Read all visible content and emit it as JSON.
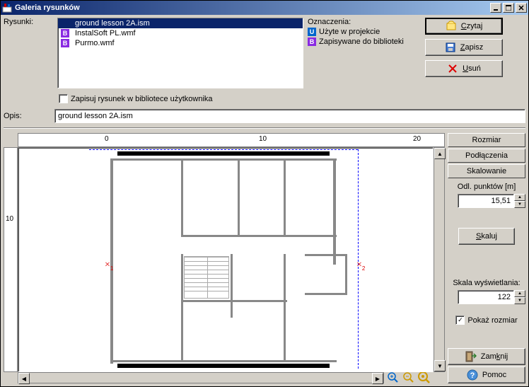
{
  "titlebar": {
    "text": "Galeria rysunków"
  },
  "labels": {
    "rysunki": "Rysunki:",
    "oznaczenia": "Oznaczenia:",
    "opis": "Opis:",
    "save_checkbox": "Zapisuj rysunek w bibliotece użytkownika"
  },
  "files": [
    {
      "icon": "",
      "name": "ground lesson 2A.ism",
      "selected": true
    },
    {
      "icon": "B",
      "name": "InstalSoft PL.wmf",
      "selected": false
    },
    {
      "icon": "B",
      "name": "Purmo.wmf",
      "selected": false
    }
  ],
  "legend": [
    {
      "icon": "U",
      "icon_class": "u",
      "text": "Użyte w projekcie"
    },
    {
      "icon": "B",
      "icon_class": "b",
      "text": "Zapisywane do biblioteki"
    }
  ],
  "buttons": {
    "czytaj": "Czytaj",
    "zapisz": "Zapisz",
    "usun": "Usuń",
    "skaluj": "Skaluj",
    "zamknij": "Zamknij",
    "pomoc": "Pomoc"
  },
  "opis_value": "ground lesson 2A.ism",
  "ruler": {
    "h0": "0",
    "h10": "10",
    "h20": "20",
    "v10": "10"
  },
  "side": {
    "tab_rozmiar": "Rozmiar",
    "tab_podlaczenia": "Podłączenia",
    "tab_skalowanie": "Skalowanie",
    "odl_label": "Odl. punktów [m]",
    "odl_value": "15,51",
    "skala_label": "Skala wyświetlania:",
    "skala_value": "122",
    "pokaz_rozmiar": "Pokaż rozmiar",
    "pokaz_checked": "✓"
  }
}
